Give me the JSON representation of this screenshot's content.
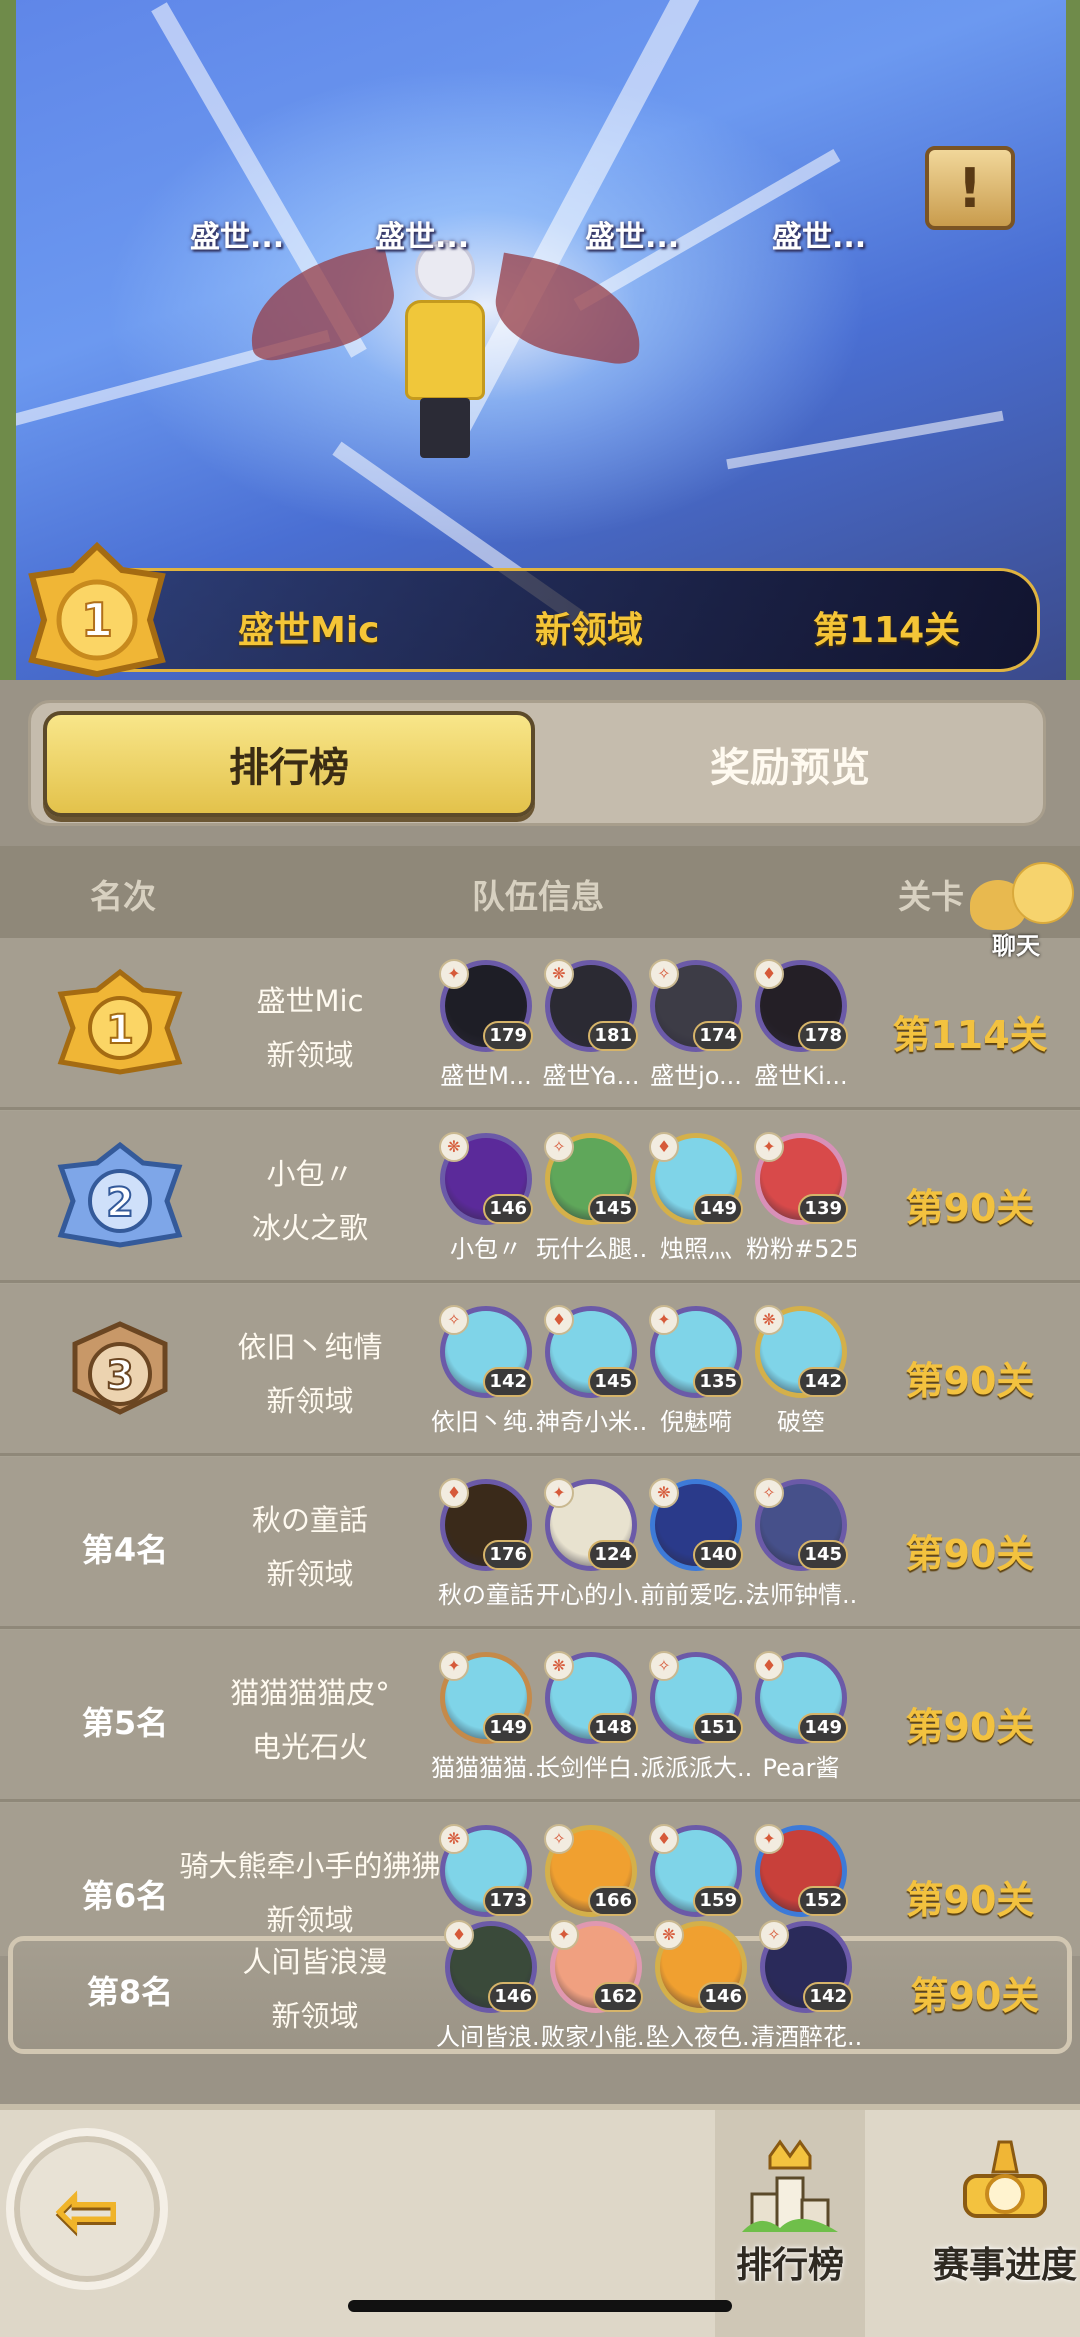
{
  "hero": {
    "player_tags": [
      "盛世...",
      "盛世...",
      "盛世...",
      "盛世..."
    ],
    "alert_icon": "exclamation-scroll-icon",
    "top_rank": "1",
    "top_player": "盛世Mic",
    "top_team": "新领域",
    "top_level": "第114关"
  },
  "tabs": {
    "ranking": "排行榜",
    "reward_preview": "奖励预览"
  },
  "table": {
    "headers": {
      "rank": "名次",
      "team": "队伍信息",
      "level": "关卡"
    },
    "chat_label": "聊天",
    "rows": [
      {
        "rank": "1",
        "line1": "盛世Mic",
        "line2": "新领域",
        "level": "第114关",
        "members": [
          {
            "lv": "179",
            "name": "盛世M..."
          },
          {
            "lv": "181",
            "name": "盛世Ya..."
          },
          {
            "lv": "174",
            "name": "盛世jo..."
          },
          {
            "lv": "178",
            "name": "盛世Ki..."
          }
        ]
      },
      {
        "rank": "2",
        "line1": "小包〃",
        "line2": "冰火之歌",
        "level": "第90关",
        "members": [
          {
            "lv": "146",
            "name": "小包〃"
          },
          {
            "lv": "145",
            "name": "玩什么腿..."
          },
          {
            "lv": "149",
            "name": "烛照灬"
          },
          {
            "lv": "139",
            "name": "粉粉#525"
          }
        ]
      },
      {
        "rank": "3",
        "line1": "依旧丶纯情",
        "line2": "新领域",
        "level": "第90关",
        "members": [
          {
            "lv": "142",
            "name": "依旧丶纯..."
          },
          {
            "lv": "145",
            "name": "神奇小米..."
          },
          {
            "lv": "135",
            "name": "倪魅嗬"
          },
          {
            "lv": "142",
            "name": "破箜"
          }
        ]
      },
      {
        "rank": "第4名",
        "line1": "秋の童話",
        "line2": "新领域",
        "level": "第90关",
        "members": [
          {
            "lv": "176",
            "name": "秋の童話"
          },
          {
            "lv": "124",
            "name": "开心的小..."
          },
          {
            "lv": "140",
            "name": "前前爱吃..."
          },
          {
            "lv": "145",
            "name": "法师钟情..."
          }
        ]
      },
      {
        "rank": "第5名",
        "line1": "猫猫猫猫皮°",
        "line2": "电光石火",
        "level": "第90关",
        "members": [
          {
            "lv": "149",
            "name": "猫猫猫猫..."
          },
          {
            "lv": "148",
            "name": "长剑伴白..."
          },
          {
            "lv": "151",
            "name": "派派派大..."
          },
          {
            "lv": "149",
            "name": "Pear酱"
          }
        ]
      },
      {
        "rank": "第6名",
        "line1": "骑大熊牵小手的狒狒",
        "line2": "新领域",
        "level": "第90关",
        "members": [
          {
            "lv": "173",
            "name": ""
          },
          {
            "lv": "166",
            "name": ""
          },
          {
            "lv": "159",
            "name": ""
          },
          {
            "lv": "152",
            "name": ""
          }
        ]
      }
    ],
    "own": {
      "rank": "第8名",
      "line1": "人间皆浪漫",
      "line2": "新领域",
      "level": "第90关",
      "members": [
        {
          "lv": "146",
          "name": "人间皆浪..."
        },
        {
          "lv": "162",
          "name": "败家小能..."
        },
        {
          "lv": "146",
          "name": "坠入夜色..."
        },
        {
          "lv": "142",
          "name": "清酒醉花..."
        }
      ]
    }
  },
  "bottom_nav": {
    "back_icon": "back-arrow-icon",
    "ranking_label": "排行榜",
    "progress_label": "赛事进度"
  },
  "colors": {
    "gold": "#f3c23f",
    "panel": "#a59e90",
    "tab_active": "#e3c24b"
  }
}
